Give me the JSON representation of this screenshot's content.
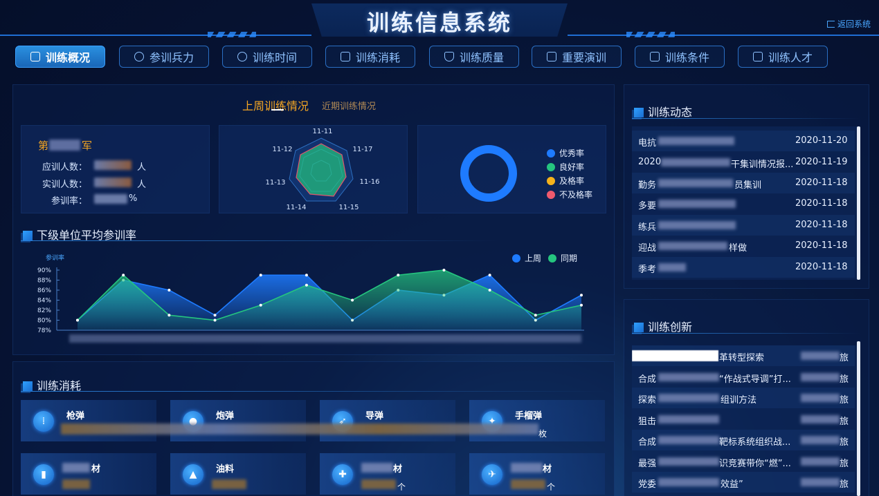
{
  "header": {
    "title": "训练信息系统",
    "back_label": "返回系统"
  },
  "tabs": [
    {
      "label": "训练概况",
      "active": true,
      "icon": "chart-icon"
    },
    {
      "label": "参训兵力",
      "active": false,
      "icon": "user-icon"
    },
    {
      "label": "训练时间",
      "active": false,
      "icon": "clock-icon"
    },
    {
      "label": "训练消耗",
      "active": false,
      "icon": "hourglass-icon"
    },
    {
      "label": "训练质量",
      "active": false,
      "icon": "shield-icon"
    },
    {
      "label": "重要演训",
      "active": false,
      "icon": "org-chart-icon"
    },
    {
      "label": "训练条件",
      "active": false,
      "icon": "list-icon"
    },
    {
      "label": "训练人才",
      "active": false,
      "icon": "calendar-icon"
    }
  ],
  "overview": {
    "tab_active": "上周训练情况",
    "tab_inactive": "近期训练情况",
    "army_prefix": "第",
    "army_suffix": "军",
    "stats": [
      {
        "label": "应训人数：",
        "unit": "人"
      },
      {
        "label": "实训人数：",
        "unit": "人"
      },
      {
        "label": "参训率：",
        "unit": "%"
      }
    ],
    "radar_labels": [
      "11-11",
      "11-17",
      "11-16",
      "11-15",
      "11-14",
      "11-13",
      "11-12"
    ],
    "donut_legend": [
      {
        "label": "优秀率",
        "color": "#1e7bff"
      },
      {
        "label": "良好率",
        "color": "#25c57f"
      },
      {
        "label": "及格率",
        "color": "#f5b21b"
      },
      {
        "label": "不及格率",
        "color": "#ef5a6e"
      }
    ]
  },
  "participation": {
    "title": "下级单位平均参训率"
  },
  "chart_data": {
    "type": "area",
    "ylabel": "参训率",
    "ylim": [
      78,
      90
    ],
    "y_ticks": [
      "90%",
      "88%",
      "86%",
      "84%",
      "82%",
      "80%",
      "78%"
    ],
    "series": [
      {
        "name": "上周",
        "color": "#1e7bff",
        "values": [
          80,
          88,
          86,
          81,
          89,
          89,
          80,
          86,
          85,
          89,
          80,
          85
        ]
      },
      {
        "name": "同期",
        "color": "#25c57f",
        "values": [
          80,
          89,
          81,
          80,
          83,
          87,
          84,
          89,
          90,
          86,
          81,
          83
        ]
      }
    ]
  },
  "news": {
    "title": "训练动态",
    "items": [
      {
        "prefix": "电抗",
        "suffix": "",
        "date": "2020-11-20"
      },
      {
        "prefix": "2020",
        "suffix": "干集训情况报...",
        "date": "2020-11-19"
      },
      {
        "prefix": "勤务",
        "suffix": "员集训",
        "date": "2020-11-18"
      },
      {
        "prefix": "多要",
        "suffix": "",
        "date": "2020-11-18"
      },
      {
        "prefix": "练兵",
        "suffix": "",
        "date": "2020-11-18"
      },
      {
        "prefix": "迎战",
        "suffix": "样做",
        "date": "2020-11-18"
      },
      {
        "prefix": "季考",
        "suffix": "",
        "date": "2020-11-18"
      }
    ]
  },
  "innovation": {
    "title": "训练创新",
    "items": [
      {
        "prefix": "",
        "suffix": "革转型探索",
        "tail": "旅"
      },
      {
        "prefix": "合成",
        "suffix": "“作战式导调”打...",
        "tail": "旅"
      },
      {
        "prefix": "探索",
        "suffix": "组训方法",
        "tail": "旅"
      },
      {
        "prefix": "狙击",
        "suffix": "",
        "tail": "旅"
      },
      {
        "prefix": "合成",
        "suffix": "靶标系统组织战...",
        "tail": "旅"
      },
      {
        "prefix": "最强",
        "suffix": "识竞赛带你“燃”...",
        "tail": "旅"
      },
      {
        "prefix": "党委",
        "suffix": "效益”",
        "tail": "旅"
      }
    ]
  },
  "consumption": {
    "title": "训练消耗",
    "items": [
      {
        "name": "枪弹",
        "unit": "",
        "icon": "bullet-icon"
      },
      {
        "name": "炮弹",
        "unit": "",
        "icon": "shell-icon"
      },
      {
        "name": "导弹",
        "unit": "",
        "icon": "missile-icon"
      },
      {
        "name": "手榴弹",
        "unit": "枚",
        "icon": "grenade-icon"
      },
      {
        "name": "材",
        "unit": "",
        "icon": "material-icon"
      },
      {
        "name": "油料",
        "unit": "",
        "icon": "fuel-icon"
      },
      {
        "name": "材",
        "unit": "个",
        "icon": "gift-icon"
      },
      {
        "name": "材",
        "unit": "个",
        "icon": "plane-icon"
      }
    ]
  }
}
